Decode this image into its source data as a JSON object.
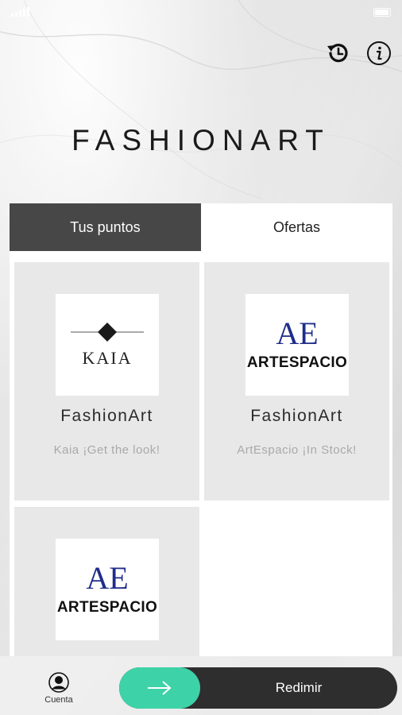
{
  "status_bar": {
    "carrier": "",
    "time": "",
    "battery": ""
  },
  "header": {
    "logo": "FASHIONART",
    "history_icon": "history-icon",
    "info_icon": "info-icon"
  },
  "tabs": [
    {
      "label": "Tus puntos",
      "active": true
    },
    {
      "label": "Ofertas",
      "active": false
    }
  ],
  "cards": [
    {
      "brand_logo": "KAIA",
      "title": "FashionArt",
      "subtitle": "Kaia ¡Get the look!"
    },
    {
      "brand_logo": "ARTESPACIO",
      "logo_mark": "AE",
      "title": "FashionArt",
      "subtitle": "ArtEspacio ¡In Stock!"
    },
    {
      "brand_logo": "ARTESPACIO",
      "logo_mark": "AE",
      "title": "",
      "subtitle": ""
    }
  ],
  "bottom_bar": {
    "account_label": "Cuenta",
    "redeem_label": "Redimir"
  },
  "colors": {
    "tab_active_bg": "#474747",
    "card_bg": "#e8e8e8",
    "accent": "#3ed2a8",
    "redeem_bg": "#2e2e2e",
    "artespacio_blue": "#1f2d8a"
  }
}
